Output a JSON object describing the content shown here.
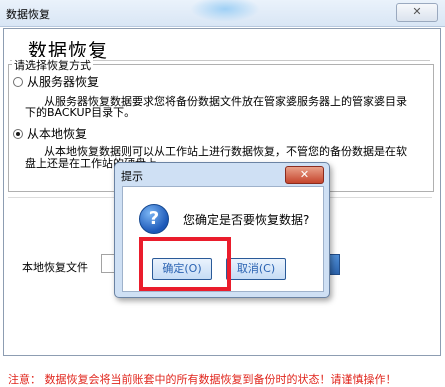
{
  "window": {
    "title": "数据恢复",
    "close_glyph": "✕"
  },
  "page": {
    "heading": "数据恢复",
    "legend": "请选择恢复方式",
    "option_server": {
      "label": "从服务器恢复",
      "checked": false,
      "desc_line1": "从服务器恢复数据要求您将备份数据文件放在管家婆服务器上的管家婆目录",
      "desc_line2": "下的BACKUP目录下。"
    },
    "option_local": {
      "label": "从本地恢复",
      "checked": true,
      "desc_line1": "从本地恢复数据则可以从工作站上进行数据恢复，不管您的备份数据是在软",
      "desc_line2": "盘上还是在工作站的硬盘上。"
    },
    "local_file_label": "本地恢复文件",
    "local_file_value": "",
    "notice": "注意：  数据恢复会将当前账套中的所有数据恢复到备份时的状态！请谨慎操作！"
  },
  "dialog": {
    "title": "提示",
    "close_glyph": "✕",
    "icon": "question-icon",
    "icon_glyph": "?",
    "message": "您确定是否要恢复数据?",
    "ok_label": "确定(O)",
    "cancel_label": "取消(C)"
  },
  "colors": {
    "highlight": "#ea1d2c",
    "notice": "#e0261d",
    "dialog_bg": "#cfe0f4"
  }
}
